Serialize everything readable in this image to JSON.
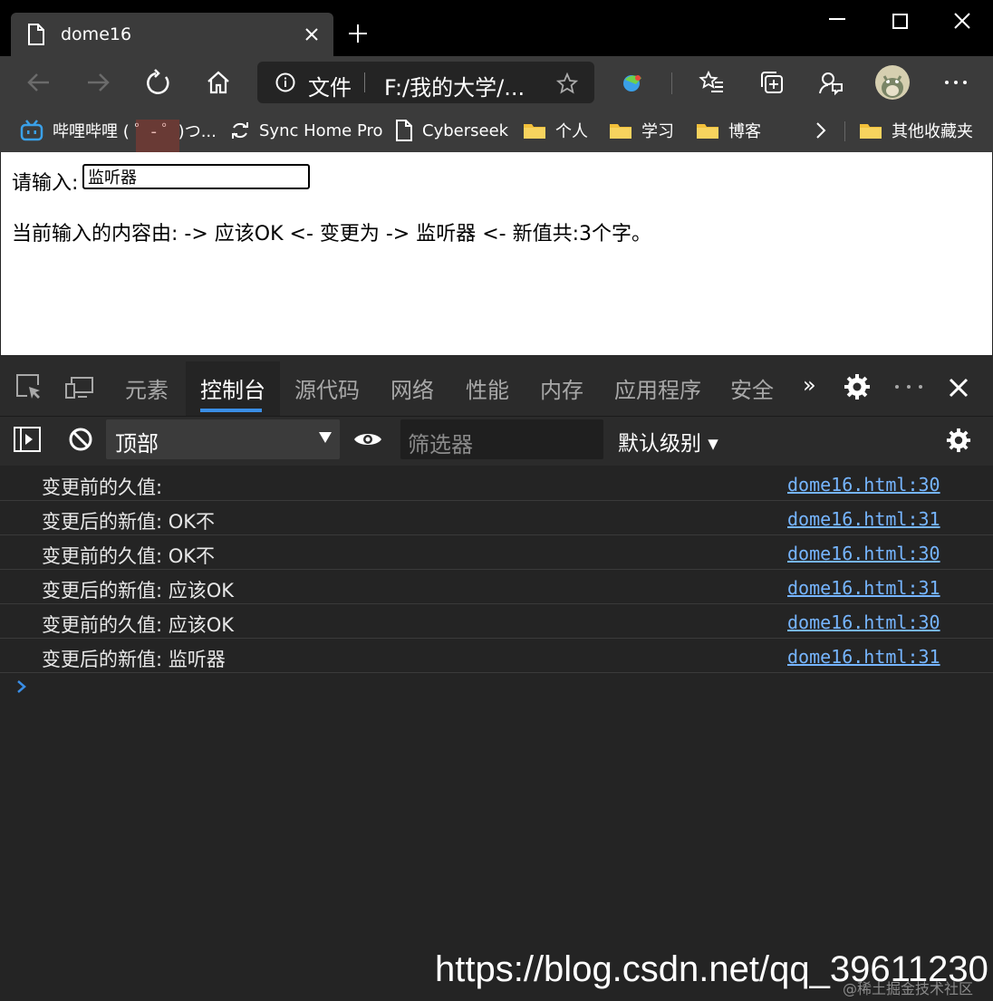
{
  "tab": {
    "title": "dome16",
    "close_label": "×",
    "new_label": "+"
  },
  "address": {
    "scheme": "文件",
    "url": "F:/我的大学/..."
  },
  "favorites": [
    {
      "label": "哔哩哔哩 ( ゜- ゜)つ...",
      "icon": "bilibili-icon"
    },
    {
      "label": "Sync Home Pro",
      "icon": "sync-icon"
    },
    {
      "label": "Cyberseek",
      "icon": "page-icon"
    },
    {
      "label": "个人",
      "icon": "folder-icon"
    },
    {
      "label": "学习",
      "icon": "folder-icon"
    },
    {
      "label": "博客",
      "icon": "folder-icon"
    },
    {
      "label": "其他收藏夹",
      "icon": "folder-icon"
    }
  ],
  "page": {
    "input_label": "请输入:",
    "input_value": "监听器",
    "result": "当前输入的内容由: -> 应该OK <- 变更为 -> 监听器 <- 新值共:3个字。"
  },
  "devtools": {
    "tabs": [
      "元素",
      "控制台",
      "源代码",
      "网络",
      "性能",
      "内存",
      "应用程序",
      "安全"
    ],
    "active_tab": "控制台",
    "more_tabs": "»",
    "context": "顶部",
    "filter_placeholder": "筛选器",
    "levels": "默认级别 ▾"
  },
  "console": [
    {
      "msg": "变更前的久值:",
      "src": "dome16.html:30"
    },
    {
      "msg": "变更后的新值: OK不",
      "src": "dome16.html:31"
    },
    {
      "msg": "变更前的久值: OK不",
      "src": "dome16.html:30"
    },
    {
      "msg": "变更后的新值: 应该OK",
      "src": "dome16.html:31"
    },
    {
      "msg": "变更前的久值: 应该OK",
      "src": "dome16.html:30"
    },
    {
      "msg": "变更后的新值: 监听器",
      "src": "dome16.html:31"
    }
  ],
  "watermark": "https://blog.csdn.net/qq_39611230",
  "watermark_small": "@稀土掘金技术社区",
  "colors": {
    "accent": "#3a8ee6",
    "link": "#76b5ff",
    "chrome_bg": "#3b3b3b",
    "devtools_bg": "#242424"
  }
}
